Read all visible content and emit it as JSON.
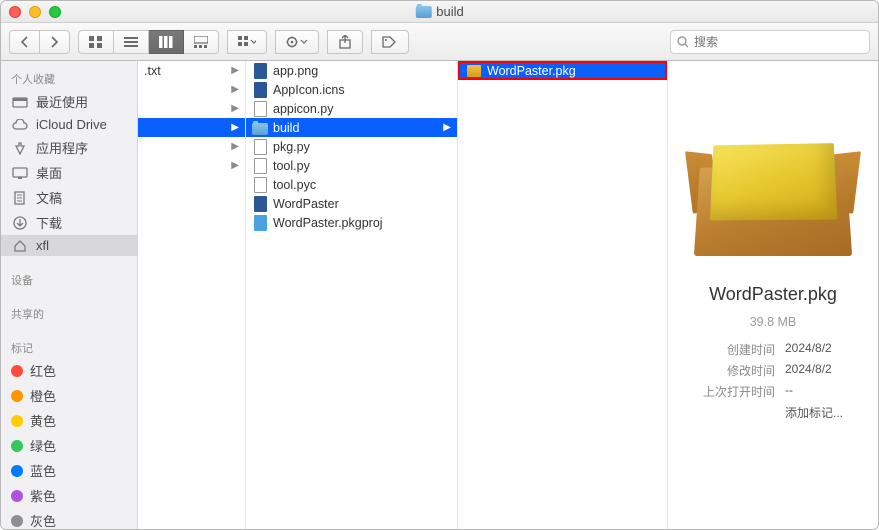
{
  "window": {
    "title": "build"
  },
  "toolbar": {
    "search_placeholder": "搜索"
  },
  "sidebar": {
    "sections": {
      "favorites": "个人收藏",
      "devices": "设备",
      "shared": "共享的",
      "tags": "标记"
    },
    "items": {
      "recents": "最近使用",
      "icloud": "iCloud Drive",
      "apps": "应用程序",
      "desktop": "桌面",
      "documents": "文稿",
      "downloads": "下载",
      "xfl": "xfl"
    },
    "tags": {
      "red": "红色",
      "orange": "橙色",
      "yellow": "黄色",
      "green": "绿色",
      "blue": "蓝色",
      "purple": "紫色",
      "gray": "灰色"
    }
  },
  "col1": {
    "item": ".txt"
  },
  "col2": {
    "items": [
      "app.png",
      "AppIcon.icns",
      "appicon.py",
      "build",
      "pkg.py",
      "tool.py",
      "tool.pyc",
      "WordPaster",
      "WordPaster.pkgproj"
    ]
  },
  "col3": {
    "item": "WordPaster.pkg"
  },
  "preview": {
    "name": "WordPaster.pkg",
    "size": "39.8 MB",
    "created_label": "创建时间",
    "created_value": "2024/8/2",
    "modified_label": "修改时间",
    "modified_value": "2024/8/2",
    "opened_label": "上次打开时间",
    "opened_value": "--",
    "add_tag": "添加标记..."
  }
}
